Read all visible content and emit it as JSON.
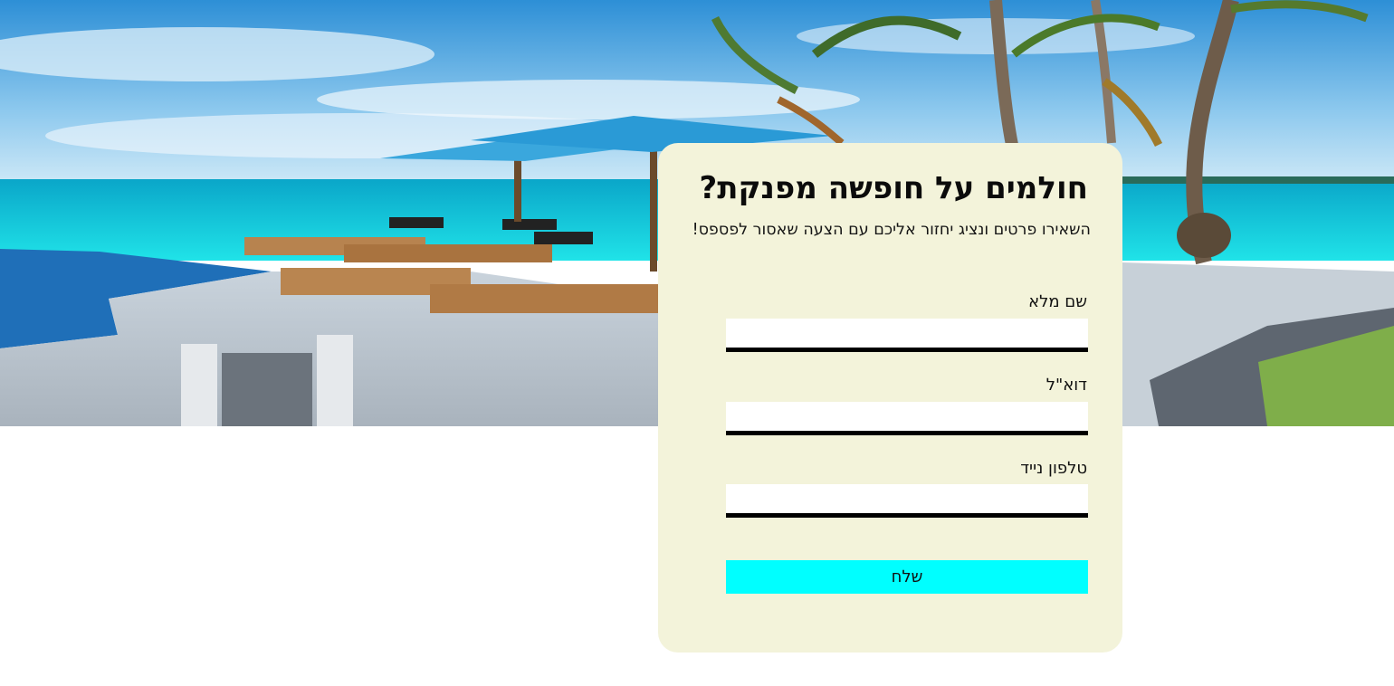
{
  "hero": {
    "image": "tropical beach resort with pool, sun loungers, umbrella and palm trees"
  },
  "form": {
    "title": "חולמים על חופשה מפנקת?",
    "subtitle": "השאירו פרטים ונציג יחזור אליכם עם הצעה שאסור לפספס!",
    "fields": [
      {
        "label": "שם מלא",
        "value": ""
      },
      {
        "label": "דוא\"ל",
        "value": ""
      },
      {
        "label": "טלפון נייד",
        "value": ""
      }
    ],
    "submit_label": "שלח"
  },
  "colors": {
    "card_background": "#f3f3da",
    "submit_background": "#00ffff",
    "input_underline": "#000000"
  }
}
